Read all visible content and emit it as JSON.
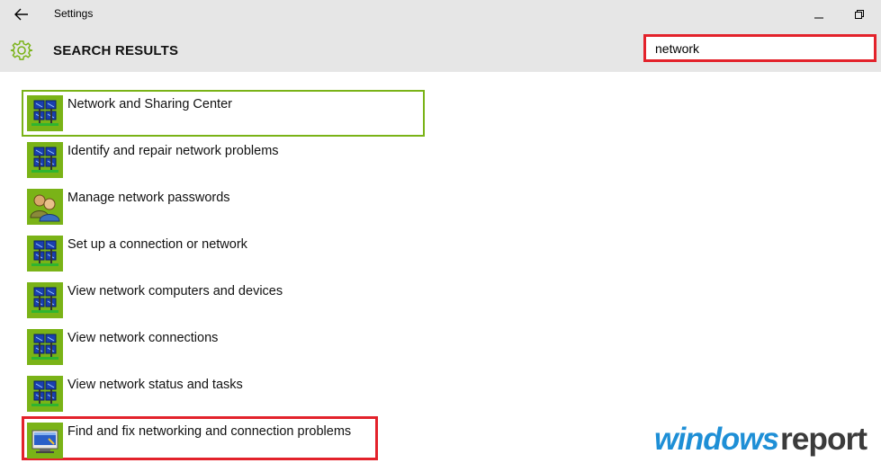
{
  "window": {
    "title": "Settings",
    "back_icon": "arrow-left-icon",
    "minimize_icon": "minimize-icon",
    "restore_icon": "restore-icon"
  },
  "header": {
    "icon": "gear-icon",
    "title": "SEARCH RESULTS",
    "accent": "#7ab317"
  },
  "search": {
    "value": "network",
    "highlight_color": "#e3222b"
  },
  "results": [
    {
      "label": "Network and Sharing Center",
      "icon": "network-icon"
    },
    {
      "label": "Identify and repair network problems",
      "icon": "network-icon"
    },
    {
      "label": "Manage network passwords",
      "icon": "users-icon"
    },
    {
      "label": "Set up a connection or network",
      "icon": "network-icon"
    },
    {
      "label": "View network computers and devices",
      "icon": "network-icon"
    },
    {
      "label": "View network connections",
      "icon": "network-icon"
    },
    {
      "label": "View network status and tasks",
      "icon": "network-icon"
    },
    {
      "label": "Find and fix networking and connection problems",
      "icon": "troubleshoot-icon"
    }
  ],
  "watermark": {
    "part1": "windows",
    "part2": "report",
    "part1_color": "#1e8fd6",
    "part2_color": "#3b3b3b"
  }
}
